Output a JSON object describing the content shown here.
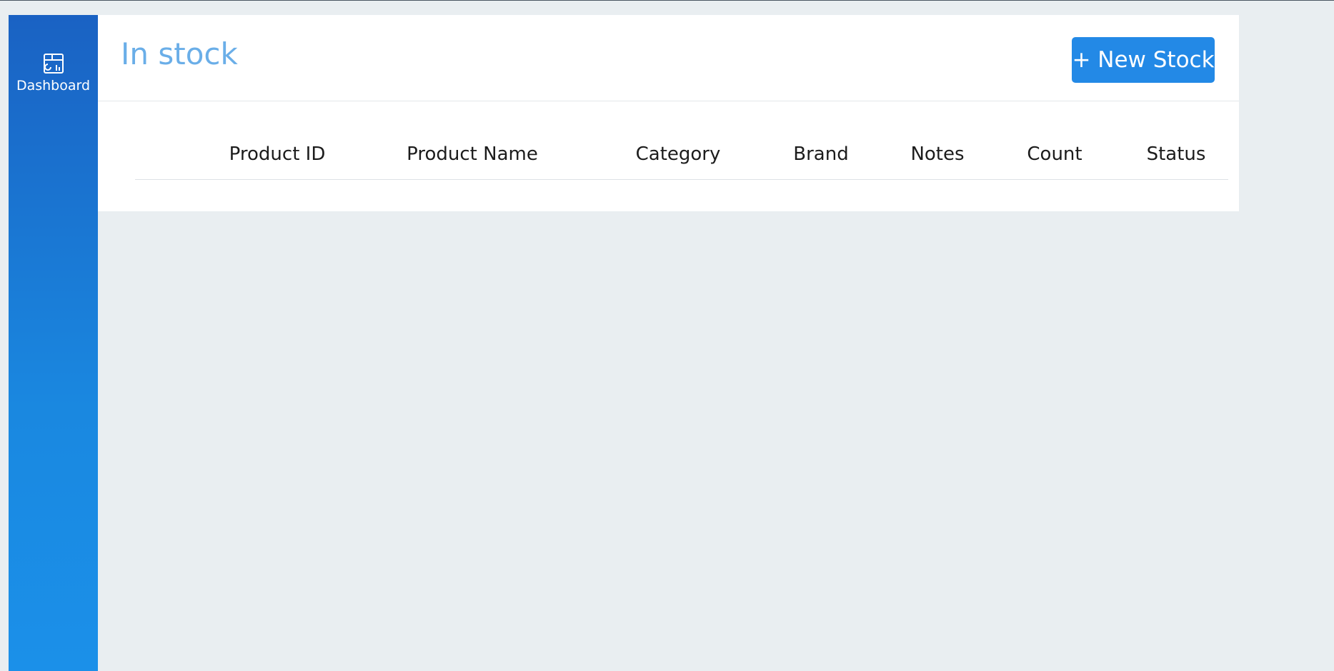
{
  "sidebar": {
    "items": [
      {
        "label": "Dashboard",
        "icon": "dashboard-chart-icon"
      }
    ],
    "gradient_top": "#1a62c3",
    "gradient_bottom": "#1b90e9"
  },
  "header": {
    "title": "In stock",
    "new_button_label": "+ New Stock",
    "title_color": "#6aaee8",
    "button_color": "#2389e6"
  },
  "table": {
    "columns": [
      "Product ID",
      "Product Name",
      "Category",
      "Brand",
      "Notes",
      "Count",
      "Status"
    ],
    "rows": []
  }
}
